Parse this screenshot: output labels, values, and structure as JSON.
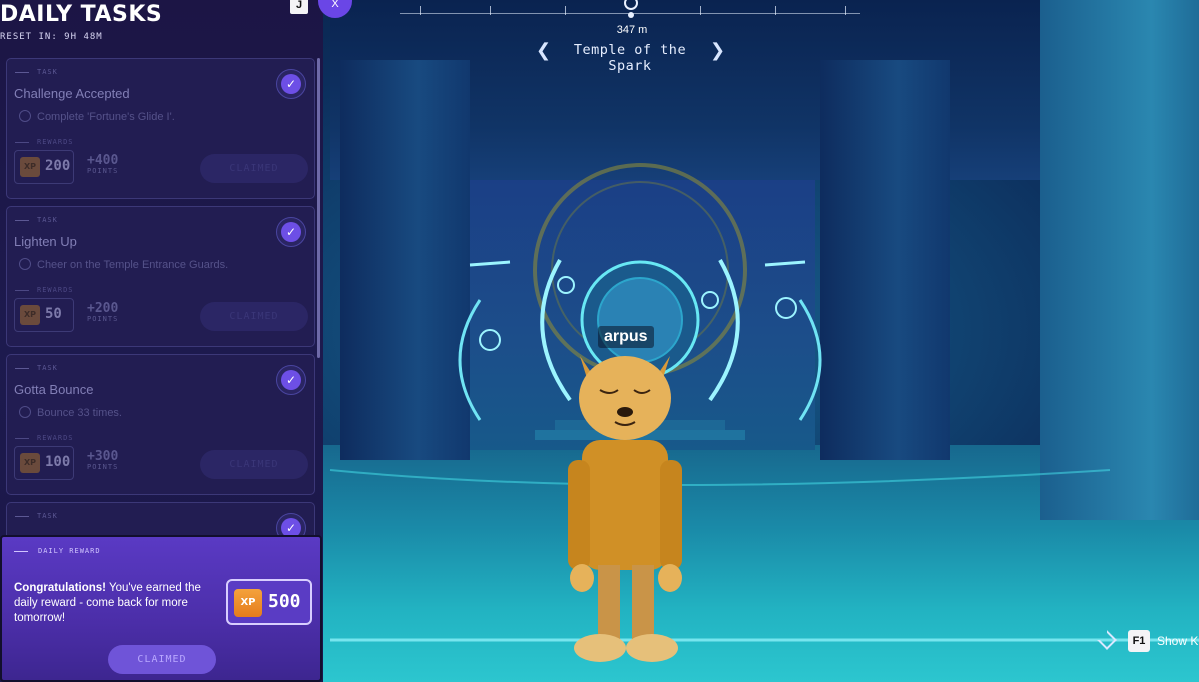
{
  "hud": {
    "key_j": "J",
    "close_button": "X",
    "compass_distance": "347 m",
    "location_name": "Temple of the Spark",
    "player_name": "arpus",
    "hint_key": "F1",
    "hint_label": "Show Ke"
  },
  "daily_tasks": {
    "title": "DAILY TASKS",
    "reset": "RESET IN: 9H 48M",
    "task_kicker": "TASK",
    "rewards_kicker": "REWARDS",
    "points_unit": "POINTS",
    "claim_label": "CLAIMED",
    "tasks": [
      {
        "name": "Challenge Accepted",
        "description": "Complete 'Fortune's Glide I'.",
        "xp": "200",
        "points": "+400",
        "completed": true
      },
      {
        "name": "Lighten Up",
        "description": "Cheer on the Temple Entrance Guards.",
        "xp": "50",
        "points": "+200",
        "completed": true
      },
      {
        "name": "Gotta Bounce",
        "description": "Bounce 33 times.",
        "xp": "100",
        "points": "+300",
        "completed": true
      },
      {
        "name": "",
        "description": "",
        "xp": "",
        "points": "",
        "completed": true
      }
    ]
  },
  "daily_reward": {
    "kicker": "DAILY REWARD",
    "message_bold": "Congratulations!",
    "message_rest": " You've earned the daily reward - come back for more tomorrow!",
    "xp_badge": "XP",
    "xp": "500",
    "claim_label": "CLAIMED"
  },
  "icons": {
    "xp_badge": "xp-badge-icon",
    "check": "check-icon",
    "chevron_left": "chevron-left-icon",
    "chevron_right": "chevron-right-icon",
    "compass_marker": "waypoint-icon",
    "hint_diamond": "diamond-icon"
  },
  "colors": {
    "accent": "#6d4fe6",
    "panel_bg": "#1d1a4e",
    "reward_bg": "#5a3ac4",
    "xp_orange": "#f4a23c"
  }
}
